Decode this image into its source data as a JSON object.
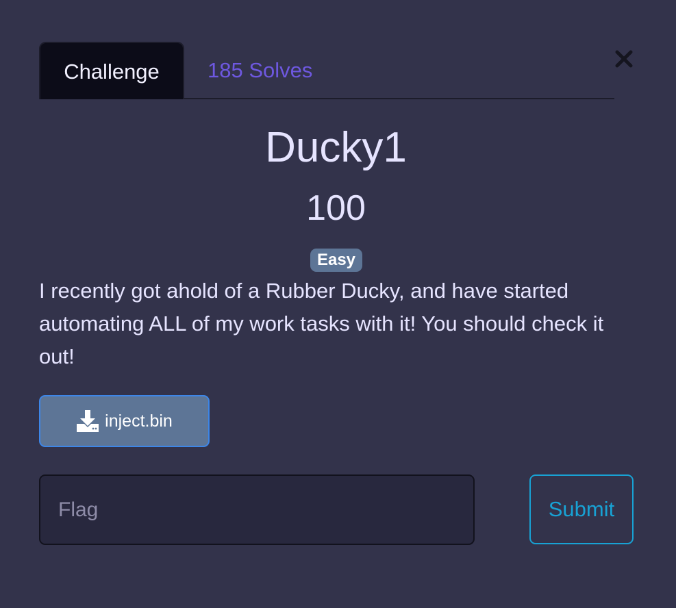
{
  "tabs": {
    "challenge_label": "Challenge",
    "solves_label": "185 Solves"
  },
  "close": {
    "icon": "close-icon"
  },
  "challenge": {
    "title": "Ducky1",
    "points": "100",
    "difficulty": "Easy",
    "description": "I recently got ahold of a Rubber Ducky, and have started automating ALL of my work tasks with it! You should check it out!"
  },
  "file": {
    "icon": "download-icon",
    "name": "inject.bin"
  },
  "flag_form": {
    "placeholder": "Flag",
    "value": "",
    "submit_label": "Submit"
  },
  "colors": {
    "background": "#33334b",
    "accent_purple": "#6e58e0",
    "badge": "#5d7596",
    "submit": "#18a2d4"
  }
}
